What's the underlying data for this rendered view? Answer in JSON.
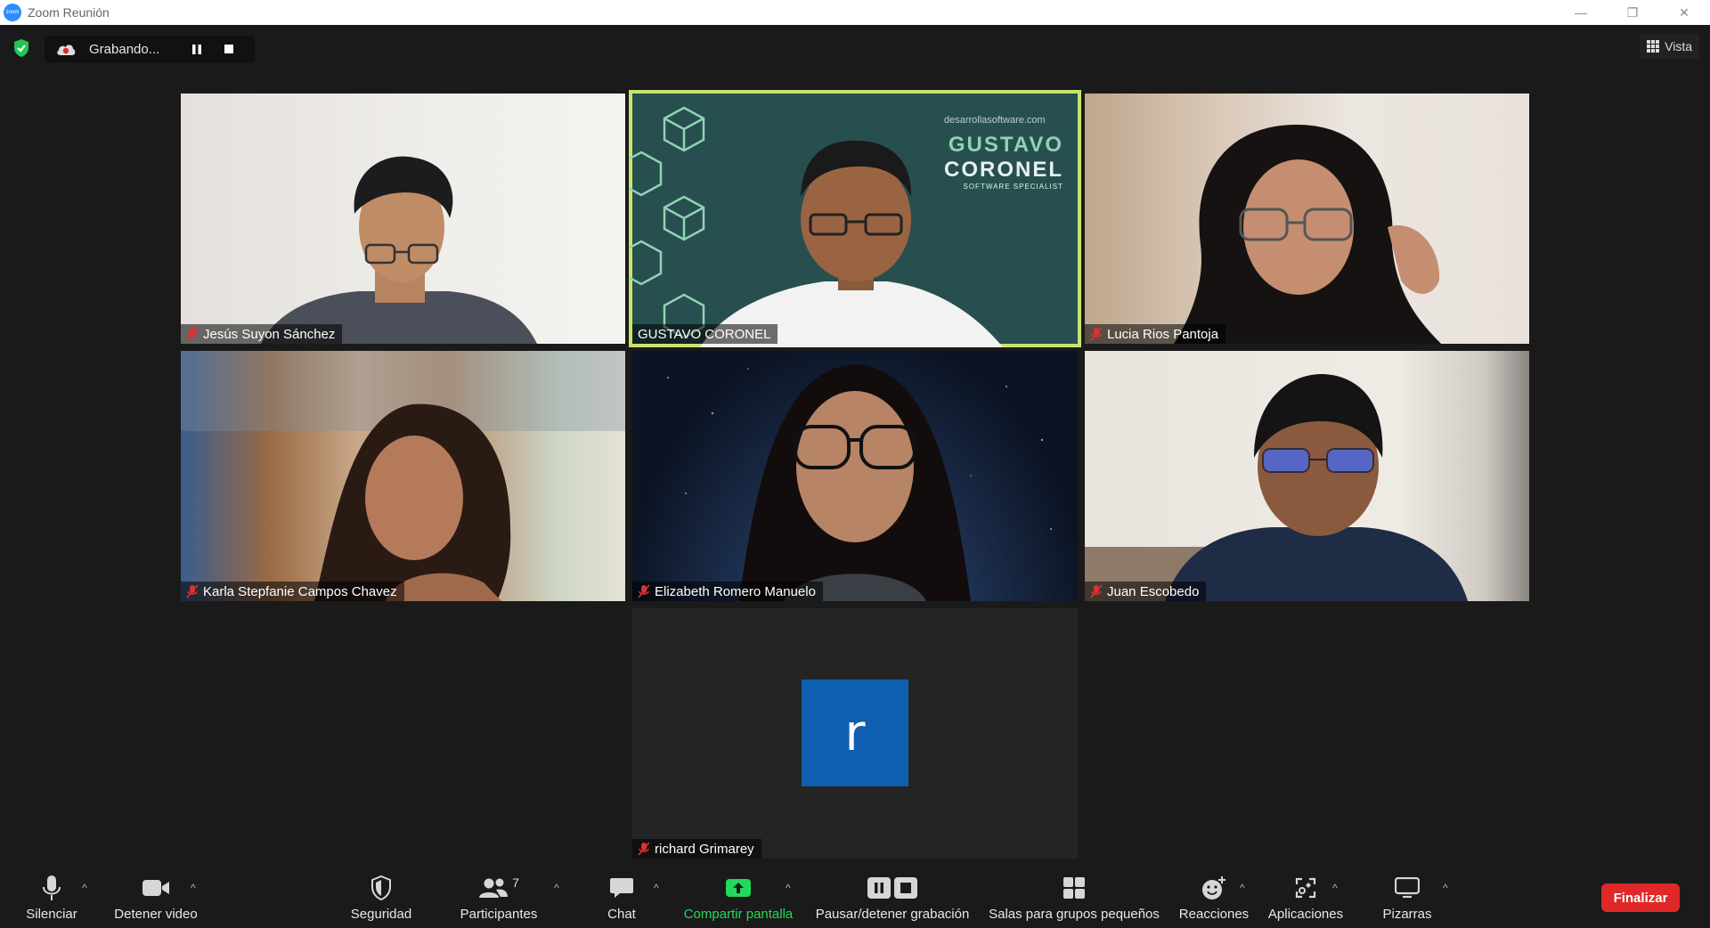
{
  "window": {
    "title": "Zoom Reunión",
    "minimize": "—",
    "restore": "❐",
    "close": "✕"
  },
  "recording": {
    "status": "Grabando...",
    "pause_icon": "pause-icon",
    "stop_icon": "stop-icon"
  },
  "view": {
    "label": "Vista"
  },
  "participants": [
    {
      "name": "Jesús Suyon Sánchez",
      "muted": true
    },
    {
      "name": "GUSTAVO CORONEL",
      "muted": false,
      "active_speaker": true,
      "background": {
        "site": "desarrollasoftware.com",
        "line1": "GUSTAVO",
        "line2": "CORONEL",
        "line3": "SOFTWARE SPECIALIST"
      }
    },
    {
      "name": "Lucia Rios Pantoja",
      "muted": true
    },
    {
      "name": "Karla Stepfanie Campos Chavez",
      "muted": true
    },
    {
      "name": "Elizabeth Romero Manuelo",
      "muted": true
    },
    {
      "name": "Juan Escobedo",
      "muted": true
    },
    {
      "name": "richard Grimarey",
      "muted": true,
      "avatar_letter": "r"
    }
  ],
  "toolbar": {
    "mute": "Silenciar",
    "video": "Detener video",
    "security": "Seguridad",
    "participants": "Participantes",
    "participants_count": "7",
    "chat": "Chat",
    "share": "Compartir pantalla",
    "recording": "Pausar/detener grabación",
    "breakout": "Salas para grupos pequeños",
    "reactions": "Reacciones",
    "apps": "Aplicaciones",
    "whiteboards": "Pizarras",
    "end": "Finalizar"
  },
  "colors": {
    "active_speaker": "#c8e36d",
    "share_green": "#23d959",
    "end_red": "#e02828",
    "avatar_blue": "#0e5fb0"
  }
}
